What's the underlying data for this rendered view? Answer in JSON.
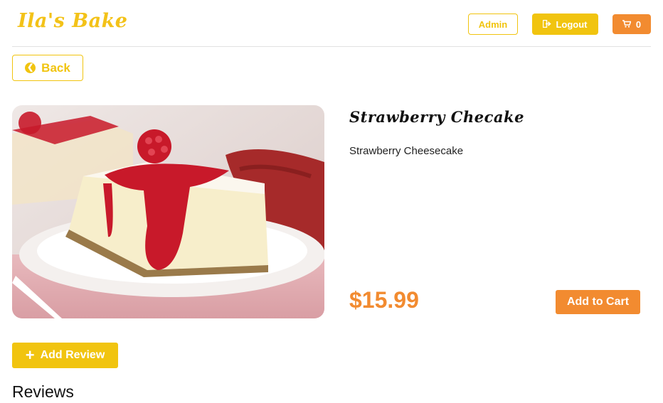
{
  "header": {
    "brand": "Ila's Bake",
    "admin_label": "Admin",
    "logout_label": "Logout",
    "cart_count": "0"
  },
  "nav": {
    "back_label": "Back"
  },
  "product": {
    "title": "Strawberry Checake",
    "description": "Strawberry Cheesecake",
    "price": "$15.99",
    "add_to_cart_label": "Add to Cart"
  },
  "reviews": {
    "add_review_label": "Add Review",
    "heading": "Reviews"
  },
  "icons": {
    "logout": "sign-out-icon",
    "cart": "shopping-cart-icon",
    "back": "arrow-circle-left-icon",
    "add_review": "plus-icon"
  },
  "colors": {
    "yellow": "#f1c40f",
    "orange": "#f28b30"
  }
}
